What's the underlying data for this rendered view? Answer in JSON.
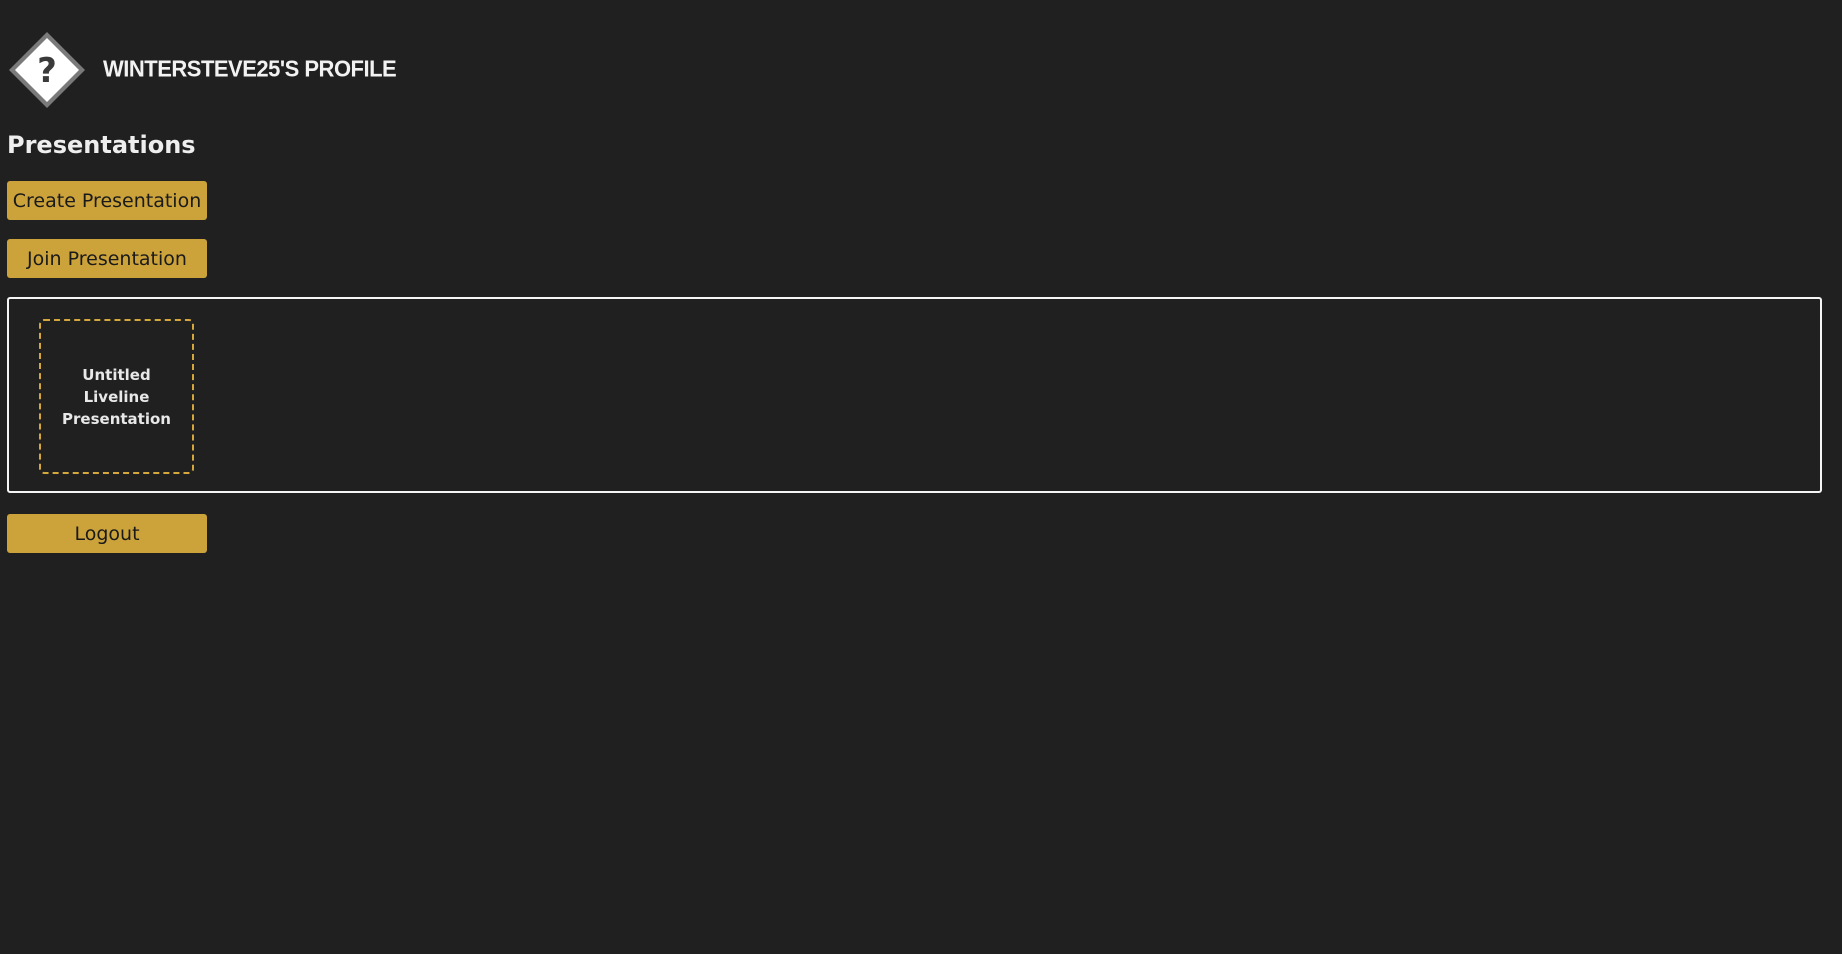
{
  "profile": {
    "title": "WINTERSTEVE25'S PROFILE",
    "avatar_icon": "question-mark-diamond-icon"
  },
  "presentations": {
    "heading": "Presentations",
    "create_label": "Create Presentation",
    "join_label": "Join Presentation",
    "items": [
      {
        "title": "Untitled Liveline Presentation"
      }
    ]
  },
  "logout_label": "Logout",
  "colors": {
    "background": "#202020",
    "accent": "#cca33b",
    "card_border": "#d4a83c",
    "list_border": "#f5f5f5"
  }
}
